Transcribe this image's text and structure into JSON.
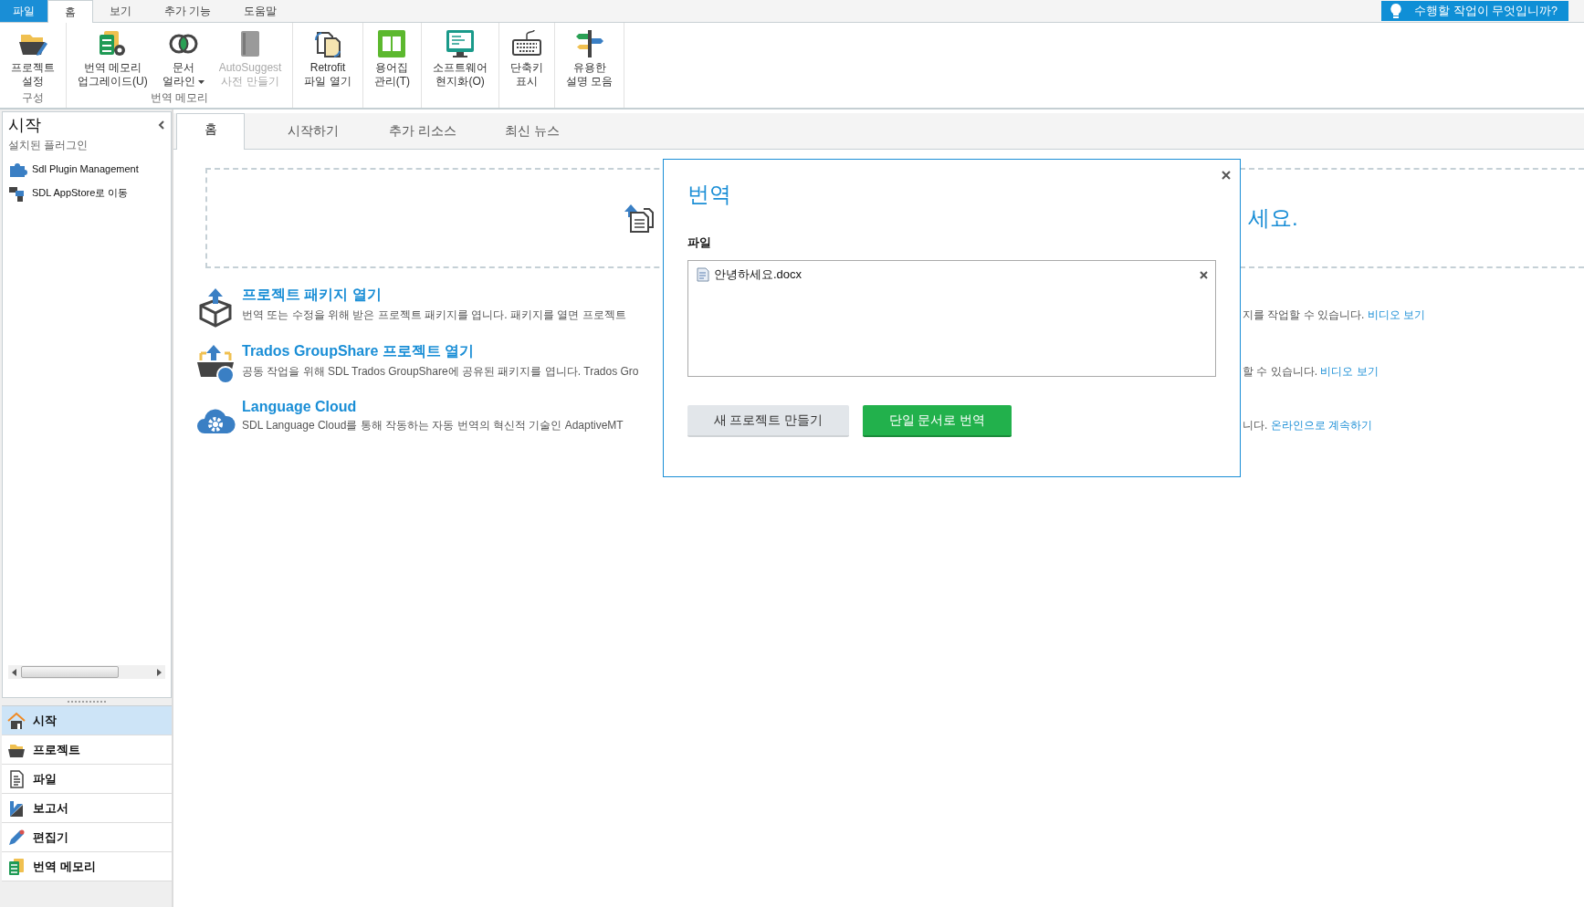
{
  "menu_tabs": [
    {
      "label": "파일",
      "kind": "file",
      "selected": false
    },
    {
      "label": "홈",
      "kind": "tab",
      "selected": true
    },
    {
      "label": "보기",
      "kind": "tab",
      "selected": false
    },
    {
      "label": "추가 기능",
      "kind": "tab",
      "selected": false
    },
    {
      "label": "도움말",
      "kind": "tab",
      "selected": false
    }
  ],
  "tell_me": "수행할 작업이 무엇입니까?",
  "ribbon_groups": [
    {
      "label": "구성",
      "buttons": [
        {
          "lines": [
            "프로젝트",
            "설정"
          ],
          "disabled": false,
          "has_menu": false
        }
      ]
    },
    {
      "label": "번역 메모리",
      "buttons": [
        {
          "lines": [
            "번역 메모리",
            "업그레이드(U)"
          ],
          "disabled": false,
          "has_menu": false
        },
        {
          "lines": [
            "문서",
            "얼라인"
          ],
          "disabled": false,
          "has_menu": true
        },
        {
          "lines": [
            "AutoSuggest",
            "사전 만들기"
          ],
          "disabled": true,
          "has_menu": false
        }
      ]
    },
    {
      "buttons": [
        {
          "lines": [
            "Retrofit",
            "파일 열기"
          ],
          "disabled": false,
          "has_menu": false
        }
      ]
    },
    {
      "buttons": [
        {
          "lines": [
            "용어집",
            "관리(T)"
          ],
          "disabled": false,
          "has_menu": false
        }
      ]
    },
    {
      "buttons": [
        {
          "lines": [
            "소프트웨어",
            "현지화(O)"
          ],
          "disabled": false,
          "has_menu": false
        }
      ]
    },
    {
      "buttons": [
        {
          "lines": [
            "단축키",
            "표시"
          ],
          "disabled": false,
          "has_menu": false
        }
      ]
    },
    {
      "buttons": [
        {
          "lines": [
            "유용한",
            "설명 모음"
          ],
          "disabled": false,
          "has_menu": false
        }
      ]
    }
  ],
  "sidebar": {
    "title": "시작",
    "subtitle": "설치된 플러그인",
    "plugins": [
      "Sdl Plugin Management",
      "SDL AppStore로 이동"
    ],
    "nav_items": [
      {
        "label": "시작",
        "selected": true
      },
      {
        "label": "프로젝트",
        "selected": false
      },
      {
        "label": "파일",
        "selected": false
      },
      {
        "label": "보고서",
        "selected": false
      },
      {
        "label": "편집기",
        "selected": false
      },
      {
        "label": "번역 메모리",
        "selected": false
      }
    ]
  },
  "content_tabs": [
    {
      "label": "홈",
      "selected": true
    },
    {
      "label": "시작하기",
      "selected": false
    },
    {
      "label": "추가 리소스",
      "selected": false
    },
    {
      "label": "최신 뉴스",
      "selected": false
    }
  ],
  "drop_zone": {
    "text": "세요."
  },
  "items": [
    {
      "title": "프로젝트 패키지 열기",
      "description_left": "번역 또는 수정을 위해 받은 프로젝트 패키지를 엽니다. 패키지를 열면 프로젝트",
      "description_right": "지를 작업할 수 있습니다.",
      "link": "비디오 보기"
    },
    {
      "title": "Trados GroupShare 프로젝트 열기",
      "description_left": "공동 작업을 위해 SDL Trados GroupShare에 공유된 패키지를 엽니다. Trados Gro",
      "description_right": "할 수 있습니다.",
      "link": "비디오 보기"
    },
    {
      "title": "Language Cloud",
      "description_left": "SDL Language Cloud를 통해 작동하는 자동 번역의 혁신적 기술인 AdaptiveMT",
      "description_right": "니다.",
      "link": "온라인으로 계속하기"
    }
  ],
  "dialog": {
    "title": "번역",
    "file_label": "파일",
    "files": [
      "안녕하세요.docx"
    ],
    "buttons": [
      {
        "label": "새 프로젝트 만들기",
        "kind": "secondary"
      },
      {
        "label": "단일 문서로 번역",
        "kind": "primary"
      }
    ]
  }
}
